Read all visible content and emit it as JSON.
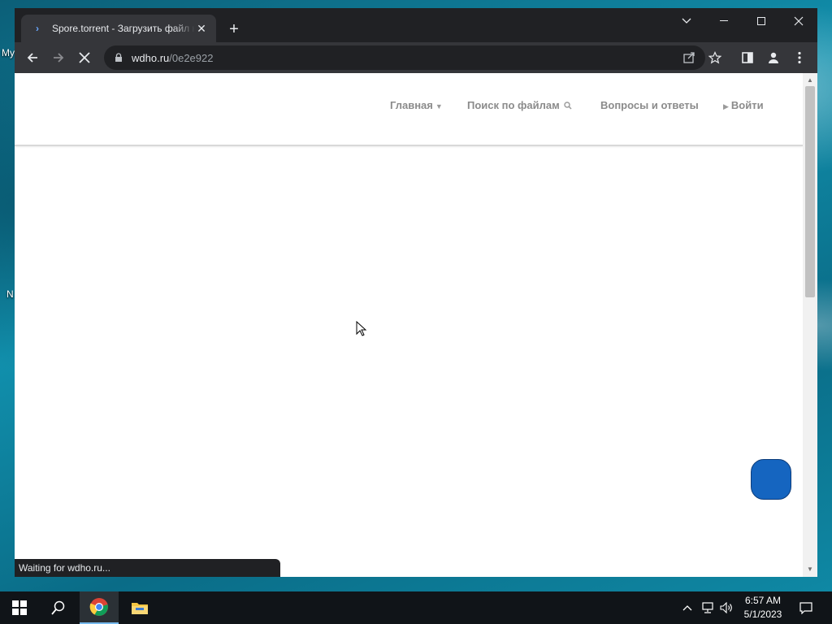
{
  "desktop": {
    "labels": [
      "My",
      "N"
    ]
  },
  "browser": {
    "tab": {
      "title": "Spore.torrent - Загрузить файл на",
      "favicon": "wdho-favicon-icon"
    },
    "new_tab_label": "+",
    "address": {
      "host": "wdho.ru",
      "path": "/0e2e922"
    },
    "status_text": "Waiting for wdho.ru..."
  },
  "site": {
    "nav": {
      "home": "Главная",
      "search": "Поиск по файлам",
      "faq": "Вопросы и ответы",
      "login": "Войти"
    },
    "chat_button_color": "#1565c0"
  },
  "taskbar": {
    "time": "6:57 AM",
    "date": "5/1/2023"
  },
  "colors": {
    "browser_dark": "#202124",
    "toolbar": "#35363a",
    "nav_text": "#8b8b8b"
  }
}
